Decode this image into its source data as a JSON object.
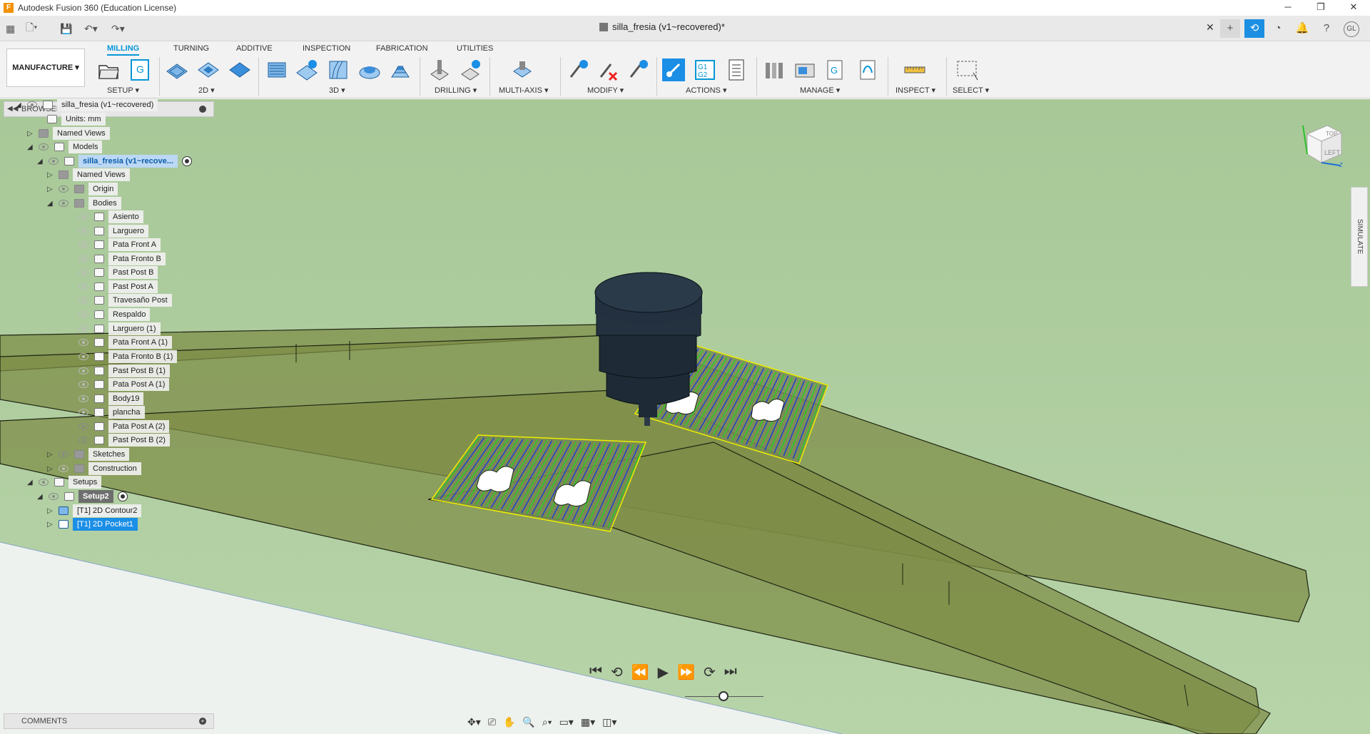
{
  "window": {
    "title": "Autodesk Fusion 360 (Education License)",
    "app_icon": "F",
    "controls": [
      "minimize-icon",
      "restore-icon",
      "close-icon"
    ]
  },
  "document_tab": {
    "name": "silla_fresia (v1~recovered)*",
    "close_label": "✕"
  },
  "user": {
    "initials": "GL"
  },
  "ribbon": {
    "workspace": "MANUFACTURE",
    "tabs": [
      "MILLING",
      "TURNING",
      "ADDITIVE",
      "INSPECTION",
      "FABRICATION",
      "UTILITIES"
    ],
    "active_tab": "MILLING",
    "groups": [
      "SETUP",
      "2D",
      "3D",
      "DRILLING",
      "MULTI-AXIS",
      "MODIFY",
      "ACTIONS",
      "MANAGE",
      "INSPECT",
      "SELECT"
    ]
  },
  "browser": {
    "title": "BROWSER",
    "nodes": [
      {
        "label": "silla_fresia (v1~recovered)"
      },
      {
        "label": "Units: mm"
      },
      {
        "label": "Named Views"
      },
      {
        "label": "Models"
      },
      {
        "label": "silla_fresia (v1~recove..."
      },
      {
        "label": "Named Views"
      },
      {
        "label": "Origin"
      },
      {
        "label": "Bodies"
      },
      {
        "label": "Asiento"
      },
      {
        "label": "Larguero"
      },
      {
        "label": "Pata Front A"
      },
      {
        "label": "Pata Fronto B"
      },
      {
        "label": "Past Post B"
      },
      {
        "label": "Past Post A"
      },
      {
        "label": "Travesaño Post"
      },
      {
        "label": "Respaldo"
      },
      {
        "label": "Larguero (1)"
      },
      {
        "label": "Pata Front A (1)"
      },
      {
        "label": "Pata Fronto B (1)"
      },
      {
        "label": "Past Post B (1)"
      },
      {
        "label": "Pata Post A (1)"
      },
      {
        "label": "Body19"
      },
      {
        "label": "plancha"
      },
      {
        "label": "Pata Post A (2)"
      },
      {
        "label": "Past Post B (2)"
      },
      {
        "label": "Sketches"
      },
      {
        "label": "Construction"
      },
      {
        "label": "Setups"
      },
      {
        "label": "Setup2"
      },
      {
        "label": "[T1] 2D Contour2"
      },
      {
        "label": "[T1] 2D Pocket1"
      }
    ]
  },
  "comments": {
    "title": "COMMENTS"
  },
  "viewcube": {
    "face_top": "TOP",
    "face_left": "LEFT",
    "axis": "Z"
  },
  "side_panel": {
    "label": "SIMULATE"
  },
  "playback": {
    "buttons": [
      "skip-start-icon",
      "step-back-icon",
      "rewind-icon",
      "play-icon",
      "fast-forward-icon",
      "step-forward-icon",
      "skip-end-icon"
    ]
  },
  "colors": {
    "accent": "#0696d7",
    "selection": "#1b8ee6",
    "viewport_bg": "#a9c99a",
    "part": "#8a9a52",
    "toolpath_blue": "#1a3bd6",
    "toolpath_green": "#22d022",
    "stock_outline": "#f0f000"
  }
}
